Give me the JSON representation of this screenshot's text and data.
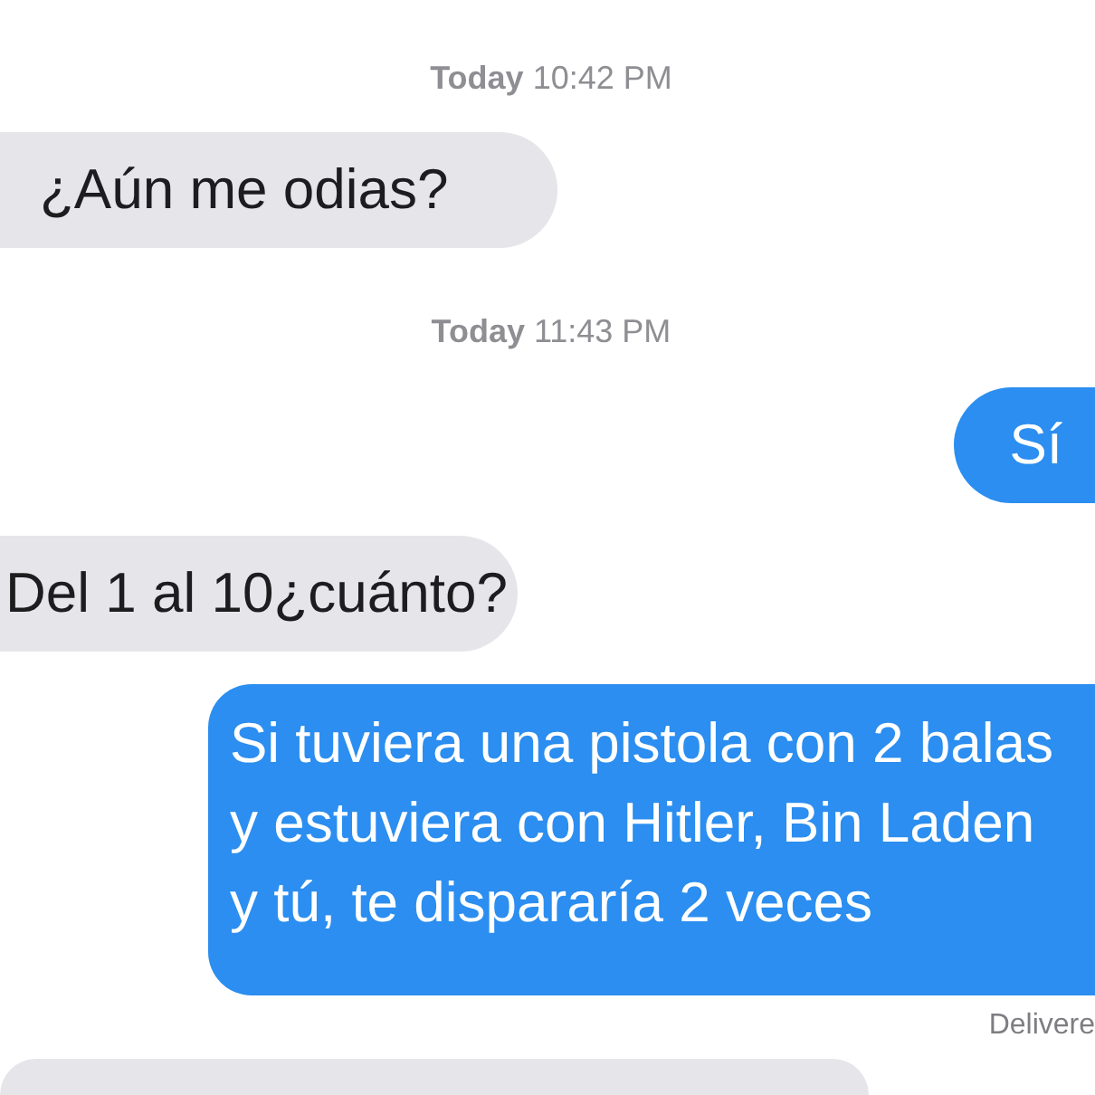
{
  "conversation": {
    "items": [
      {
        "kind": "timestamp",
        "text": "**Today** 10:42 PM"
      },
      {
        "kind": "incoming",
        "text": "¿Aún me odias?"
      },
      {
        "kind": "timestamp",
        "text": "**Today** 11:43 PM"
      },
      {
        "kind": "outgoing",
        "text": "Sí"
      },
      {
        "kind": "incoming",
        "text": "Del 1 al 10¿cuánto?"
      },
      {
        "kind": "outgoing",
        "text": "Si tuviera una pistola con 2 balas y estuviera con Hitler, Bin Laden y tú, te dispararía 2 veces"
      },
      {
        "kind": "status",
        "text": "Delivere"
      },
      {
        "kind": "incoming"
      }
    ]
  }
}
